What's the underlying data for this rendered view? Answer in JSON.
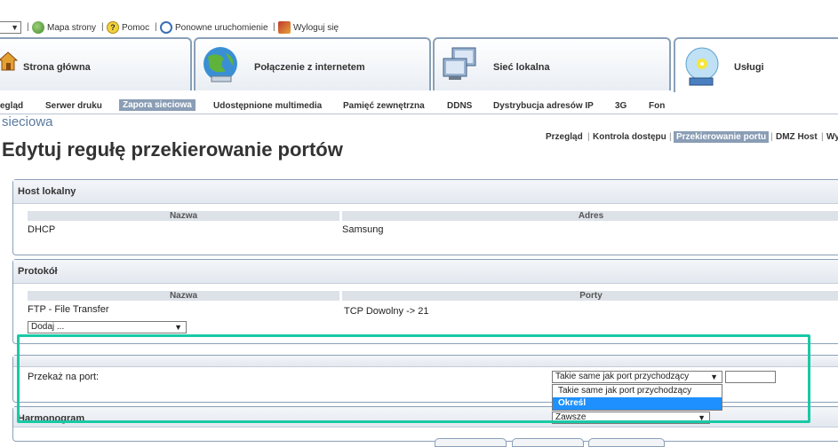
{
  "topbar": {
    "sitemap": "Mapa strony",
    "help": "Pomoc",
    "restart": "Ponowne uruchomienie",
    "logout": "Wyloguj się"
  },
  "mainnav": {
    "home": "Strona główna",
    "internet": "Połączenie z internetem",
    "lan": "Sieć lokalna",
    "services": "Usługi"
  },
  "subnav": {
    "overview": "egląd",
    "print_server": "Serwer druku",
    "firewall": "Zapora sieciowa",
    "media": "Udostępnione multimedia",
    "storage": "Pamięć zewnętrzna",
    "ddns": "DDNS",
    "ip_dist": "Dystrybucja adresów IP",
    "g3": "3G",
    "phone": "Fon"
  },
  "breadcrumb": "sieciowa",
  "tabs": {
    "overview": "Przegląd",
    "access": "Kontrola dostępu",
    "port_forward": "Przekierowanie portu",
    "dmz": "DMZ Host",
    "more": "Wy"
  },
  "title": "Edytuj regułę przekierowanie portów",
  "host_panel": {
    "heading": "Host lokalny",
    "col_name": "Nazwa",
    "col_addr": "Adres",
    "name": "DHCP",
    "addr": "Samsung"
  },
  "proto_panel": {
    "heading": "Protokół",
    "col_name": "Nazwa",
    "col_ports": "Porty",
    "name": "FTP - File Transfer",
    "ports": "TCP Dowolny -> 21",
    "add_select": "Dodaj ..."
  },
  "forward_panel": {
    "label": "Przekaż na port:",
    "select_value": "Takie same jak port przychodzący",
    "options": [
      "Takie same jak port przychodzący",
      "Określ"
    ],
    "selected_index": 1
  },
  "schedule_panel": {
    "heading": "Harmonogram",
    "select_value": "Zawsze"
  }
}
